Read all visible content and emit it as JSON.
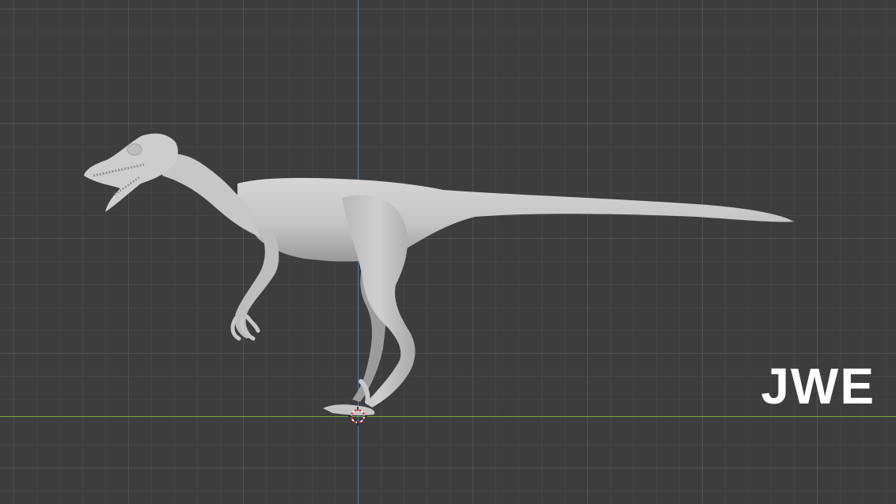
{
  "viewport": {
    "watermark": "JWE",
    "model_color": "#c9c9c9",
    "background_color": "#3d3d3d",
    "axis_z_color": "#4a7bb8",
    "axis_y_color": "#7aa53a"
  },
  "icons": {
    "cursor": "3d-cursor-icon"
  }
}
